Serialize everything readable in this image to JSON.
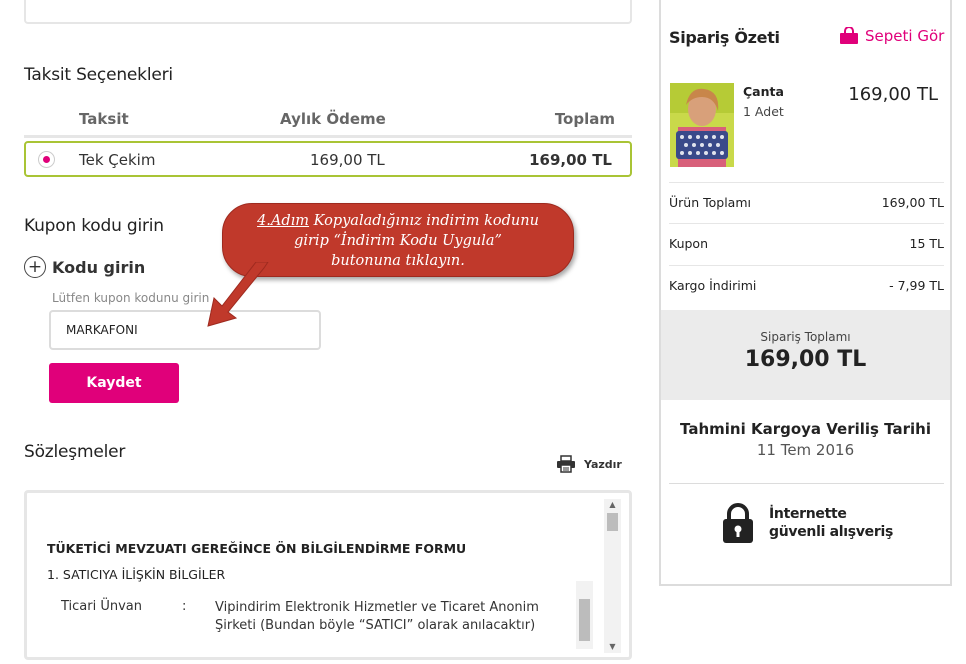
{
  "installments": {
    "title": "Taksit Seçenekleri",
    "headers": {
      "taksit": "Taksit",
      "monthly": "Aylık Ödeme",
      "total": "Toplam"
    },
    "rows": [
      {
        "name": "Tek Çekim",
        "monthly": "169,00 TL",
        "total": "169,00 TL",
        "selected": true
      }
    ]
  },
  "coupon": {
    "title": "Kupon kodu girin",
    "add_label": "Kodu girin",
    "input_label": "Lütfen kupon kodunu girin",
    "input_value": "MARKAFONI",
    "save_label": "Kaydet"
  },
  "callout": {
    "step": "4.Adım",
    "line1": "Kopyaladığınız indirim kodunu",
    "line2": "girip “İndirim Kodu Uygula”",
    "line3": "butonuna tıklayın."
  },
  "contracts": {
    "title": "Sözleşmeler",
    "print_label": "Yazdır",
    "doc_title": "TÜKETİCİ MEVZUATI GEREĞİNCE ÖN BİLGİLENDİRME FORMU",
    "section": "1. SATICIYA İLİŞKİN BİLGİLER",
    "field_key": "Ticari Ünvan",
    "field_colon": ":",
    "field_value": "Vipindirim Elektronik Hizmetler ve Ticaret Anonim Şirketi (Bundan böyle “SATICI” olarak anılacaktır)"
  },
  "summary": {
    "title": "Sipariş Özeti",
    "see_cart": "Sepeti Gör",
    "product": {
      "name": "Çanta",
      "qty": "1 Adet",
      "price": "169,00 TL"
    },
    "lines": [
      {
        "label": "Ürün Toplamı",
        "value": "169,00 TL"
      },
      {
        "label": "Kupon",
        "value": "15 TL"
      },
      {
        "label": "Kargo İndirimi",
        "value": "- 7,99 TL"
      }
    ],
    "total_label": "Sipariş Toplamı",
    "total_value": "169,00 TL",
    "ship_title": "Tahmini Kargoya Veriliş Tarihi",
    "ship_date": "11 Tem 2016",
    "secure_line1": "İnternette",
    "secure_line2": "güvenli alışveriş"
  },
  "colors": {
    "accent": "#e0007a",
    "selected_border": "#a9c435",
    "callout": "#c0392b"
  },
  "icons": [
    "plus-circle-icon",
    "printer-icon",
    "shopping-bag-icon",
    "lock-icon",
    "arrow-pointer"
  ]
}
